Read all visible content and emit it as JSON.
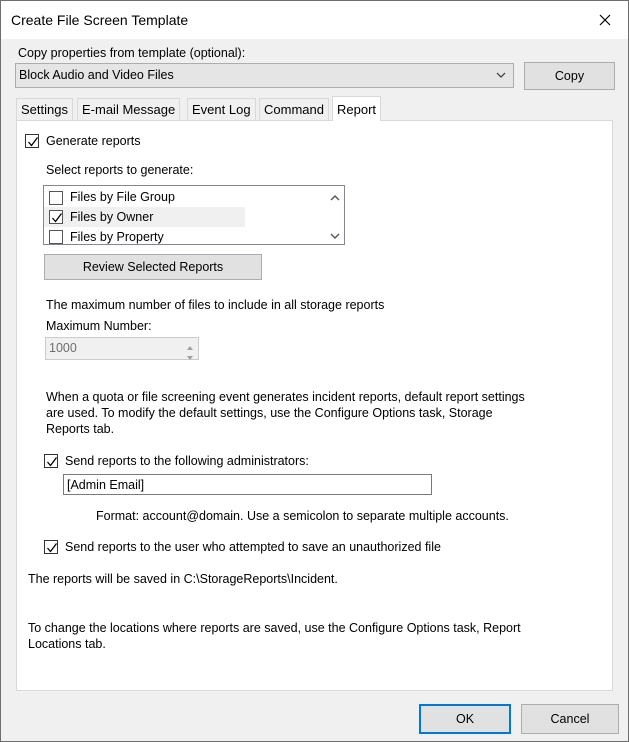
{
  "window": {
    "title": "Create File Screen Template"
  },
  "template": {
    "label": "Copy properties from template (optional):",
    "selected": "Block Audio and Video Files",
    "copy_button": "Copy"
  },
  "tabs": [
    "Settings",
    "E-mail Message",
    "Event Log",
    "Command",
    "Report"
  ],
  "report": {
    "generate_label": "Generate reports",
    "select_label": "Select reports to generate:",
    "list_items": [
      {
        "label": "Files by File Group",
        "checked": false
      },
      {
        "label": "Files by Owner",
        "checked": true
      },
      {
        "label": "Files by Property",
        "checked": false
      }
    ],
    "review_button": "Review Selected Reports",
    "max_desc": "The maximum number of files to include in all storage reports",
    "max_label": "Maximum Number:",
    "max_value": "1000",
    "info_line1": "When a quota or file screening event generates incident reports, default report settings",
    "info_line2": "are used. To modify the default settings, use the Configure Options task, Storage",
    "info_line3": "Reports tab.",
    "send_admin_label": "Send reports to the following administrators:",
    "admin_email": "[Admin Email]",
    "format_text": "Format: account@domain. Use a semicolon to separate multiple accounts.",
    "send_user_label": "Send reports to the user who attempted to save an unauthorized file",
    "saved_text": "The reports will be saved in C:\\StorageReports\\Incident.",
    "change_line1": "To change the locations where reports are saved, use the Configure Options task, Report",
    "change_line2": "Locations tab."
  },
  "footer": {
    "ok": "OK",
    "cancel": "Cancel"
  },
  "colors": {
    "accent": "#0078d7"
  }
}
